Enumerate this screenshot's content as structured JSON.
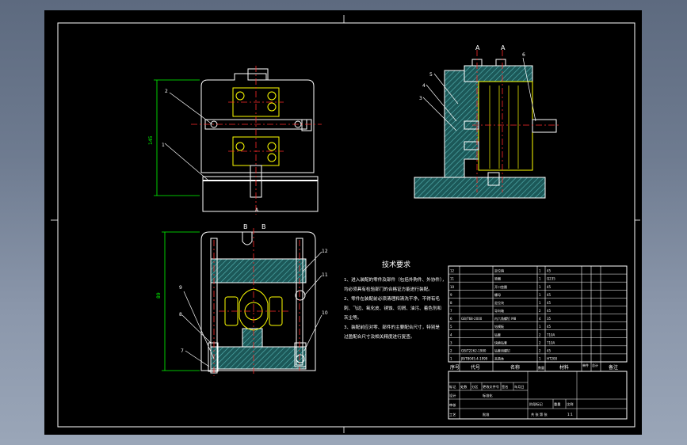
{
  "drawing": {
    "section_labels_top": [
      "A",
      "A"
    ],
    "section_labels_bottom": [
      "B",
      "B"
    ],
    "section_label_front": "A",
    "dim_height_front": "145",
    "dim_height_bottom": "89",
    "callouts": {
      "c1": "1",
      "c2": "2",
      "c3": "3",
      "c4": "4",
      "c5": "5",
      "c6": "6",
      "c7": "7",
      "c8": "8",
      "c9": "9",
      "c10": "10",
      "c11": "11",
      "c12": "12"
    }
  },
  "tech_requirements": {
    "title": "技术要求",
    "lines": [
      "1、进入装配的零件及部件（包括外购件、外协件），",
      "均必须具有检验部门的合格证方能进行装配。",
      "2、零件在装配前必须清理和清洗干净，不得有毛",
      "刺、飞边、氧化皮、锈蚀、切屑、油污、着色剂和",
      "灰尘等。",
      "3、装配前应对零、部件的主要配合尺寸，特别是",
      "过盈配合尺寸及相关精度进行复查。"
    ]
  },
  "bom": {
    "header": {
      "seq": "序号",
      "code": "代号",
      "name": "名称",
      "qty": "数量",
      "material": "材料",
      "unit": "单件",
      "total": "总计",
      "weight": "重量",
      "note": "备注"
    },
    "rows": [
      {
        "seq": "12",
        "code": "",
        "name": "定位销",
        "qty": "1",
        "material": "45"
      },
      {
        "seq": "11",
        "code": "",
        "name": "垫圈",
        "qty": "1",
        "material": "Q235"
      },
      {
        "seq": "10",
        "code": "",
        "name": "开口垫圈",
        "qty": "1",
        "material": "45"
      },
      {
        "seq": "9",
        "code": "",
        "name": "螺母",
        "qty": "1",
        "material": "45"
      },
      {
        "seq": "8",
        "code": "",
        "name": "定位块",
        "qty": "1",
        "material": "45"
      },
      {
        "seq": "7",
        "code": "",
        "name": "导向轴",
        "qty": "2",
        "material": "45"
      },
      {
        "seq": "6",
        "code": "GB/T68-2000",
        "name": "内六角螺钉 M8",
        "qty": "4",
        "material": "35"
      },
      {
        "seq": "5",
        "code": "",
        "name": "钻模板",
        "qty": "1",
        "material": "45"
      },
      {
        "seq": "4",
        "code": "",
        "name": "钻套",
        "qty": "2",
        "material": "T10A"
      },
      {
        "seq": "3",
        "code": "",
        "name": "快换钻套",
        "qty": "2",
        "material": "T10A"
      },
      {
        "seq": "2",
        "code": "GB/T2262-1980",
        "name": "钻套用螺钉",
        "qty": "2",
        "material": "45"
      },
      {
        "seq": "1",
        "code": "JB/T8045.4-1999",
        "name": "夹具体",
        "qty": "1",
        "material": "HT200"
      }
    ],
    "title_block": {
      "mark": "标记",
      "count": "处数",
      "zone": "分区",
      "change_doc": "更改文件号",
      "sign": "签名",
      "date": "年月日",
      "designer": "设计",
      "standardize": "标准化",
      "stage_mark": "阶段标记",
      "weight": "重量",
      "scale": "比例",
      "review": "审核",
      "process": "工艺",
      "approve": "批准",
      "sheet": "共 张 第 张",
      "scale_value": "1:1"
    }
  },
  "colors": {
    "background": "#000000",
    "line": "#ffffff",
    "center": "#ff2a2a",
    "part": "#ffff00",
    "dimension": "#00ff00",
    "hatch": "#2f8f8f",
    "frame_bg": "#6f7c91"
  }
}
